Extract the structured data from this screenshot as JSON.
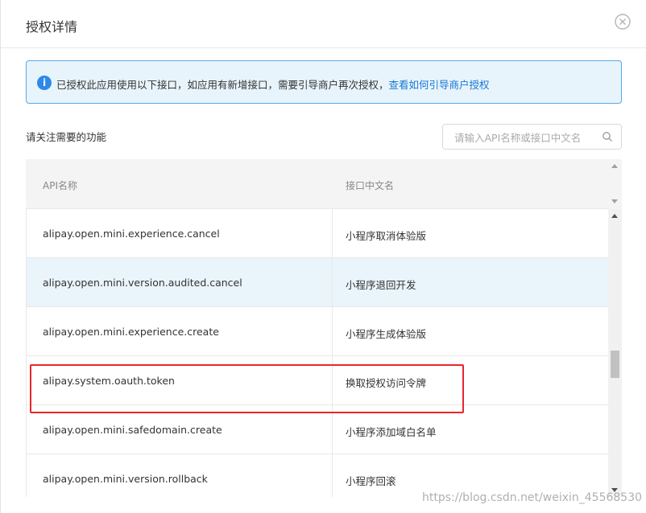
{
  "dialog": {
    "title": "授权详情"
  },
  "alert": {
    "icon_text": "i",
    "message": "已授权此应用使用以下接口，如应用有新增接口，需要引导商户再次授权，",
    "link_text": "查看如何引导商户授权"
  },
  "section": {
    "label": "请关注需要的功能"
  },
  "search": {
    "placeholder": "请输入API名称或接口中文名",
    "value": ""
  },
  "table": {
    "headers": [
      "API名称",
      "接口中文名"
    ],
    "rows": [
      {
        "api": "alipay.open.mini.experience.cancel",
        "name": "小程序取消体验版",
        "highlighted": false
      },
      {
        "api": "alipay.open.mini.version.audited.cancel",
        "name": "小程序退回开发",
        "highlighted": true
      },
      {
        "api": "alipay.open.mini.experience.create",
        "name": "小程序生成体验版",
        "highlighted": false
      },
      {
        "api": "alipay.system.oauth.token",
        "name": "换取授权访问令牌",
        "highlighted": false
      },
      {
        "api": "alipay.open.mini.safedomain.create",
        "name": "小程序添加域白名单",
        "highlighted": false
      },
      {
        "api": "alipay.open.mini.version.rollback",
        "name": "小程序回滚",
        "highlighted": false
      }
    ]
  },
  "watermark": "https://blog.csdn.net/weixin_45568530",
  "colors": {
    "accent": "#1677d2",
    "alert_border": "#5aa9e6",
    "alert_bg": "#e8f4fc",
    "row_highlight": "#eaf4fb",
    "annotation_red": "#e8262d"
  }
}
